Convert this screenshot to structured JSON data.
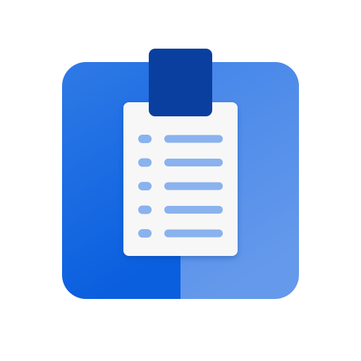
{
  "icon": {
    "name": "clipboard-checklist-app-icon",
    "list_item_count": 5
  },
  "colors": {
    "background": "#ffffff",
    "tile_left": "#0a5fdf",
    "tile_left_top": "#2f7ae6",
    "tile_right": "#5e95ea",
    "tile_right_top": "#4486ea",
    "clip": "#0a3fa0",
    "paper": "#f7f7f7",
    "bullet": "#8ab2ee",
    "line": "#8ab2ee"
  }
}
